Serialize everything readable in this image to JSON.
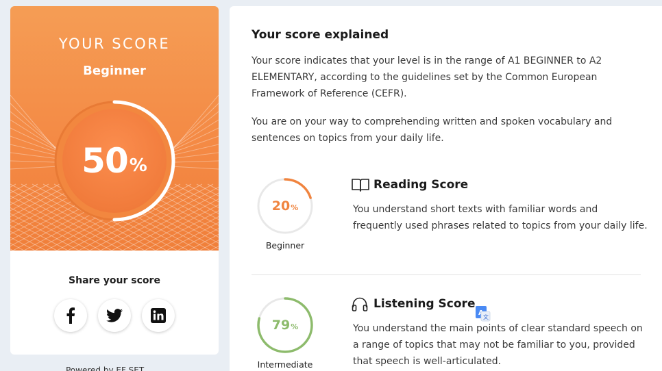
{
  "hero": {
    "title": "YOUR SCORE",
    "level": "Beginner",
    "score_value": "50",
    "score_symbol": "%",
    "score_fraction": 0.5
  },
  "share": {
    "label": "Share your score",
    "buttons": [
      {
        "name": "facebook",
        "icon": "facebook-icon"
      },
      {
        "name": "twitter",
        "icon": "twitter-icon"
      },
      {
        "name": "linkedin",
        "icon": "linkedin-icon"
      }
    ]
  },
  "powered_by": "Powered by EF SET",
  "explained": {
    "title": "Your score explained",
    "paragraph1": "Your score indicates that your level is in the range of A1 BEGINNER to A2 ELEMENTARY, according to the guidelines set by the Common European Framework of Reference (CEFR).",
    "paragraph2": "You are on your way to comprehending written and spoken vocabulary and sentences on topics from your daily life."
  },
  "reading": {
    "title": "Reading Score",
    "value": "20",
    "symbol": "%",
    "fraction": 0.2,
    "level": "Beginner",
    "description": "You understand short texts with familiar words and frequently used phrases related to topics from your daily life.",
    "icon": "book-icon"
  },
  "listening": {
    "title": "Listening Score",
    "value": "79",
    "symbol": "%",
    "fraction": 0.79,
    "level": "Intermediate",
    "description": "You understand the main points of clear standard speech on a range of topics that may not be familiar to you, provided that speech is well-articulated.",
    "icon": "headphones-icon"
  },
  "colors": {
    "accent_orange": "#f0843f",
    "green": "#8dbb6c",
    "ring_track": "#e8e8e8"
  }
}
